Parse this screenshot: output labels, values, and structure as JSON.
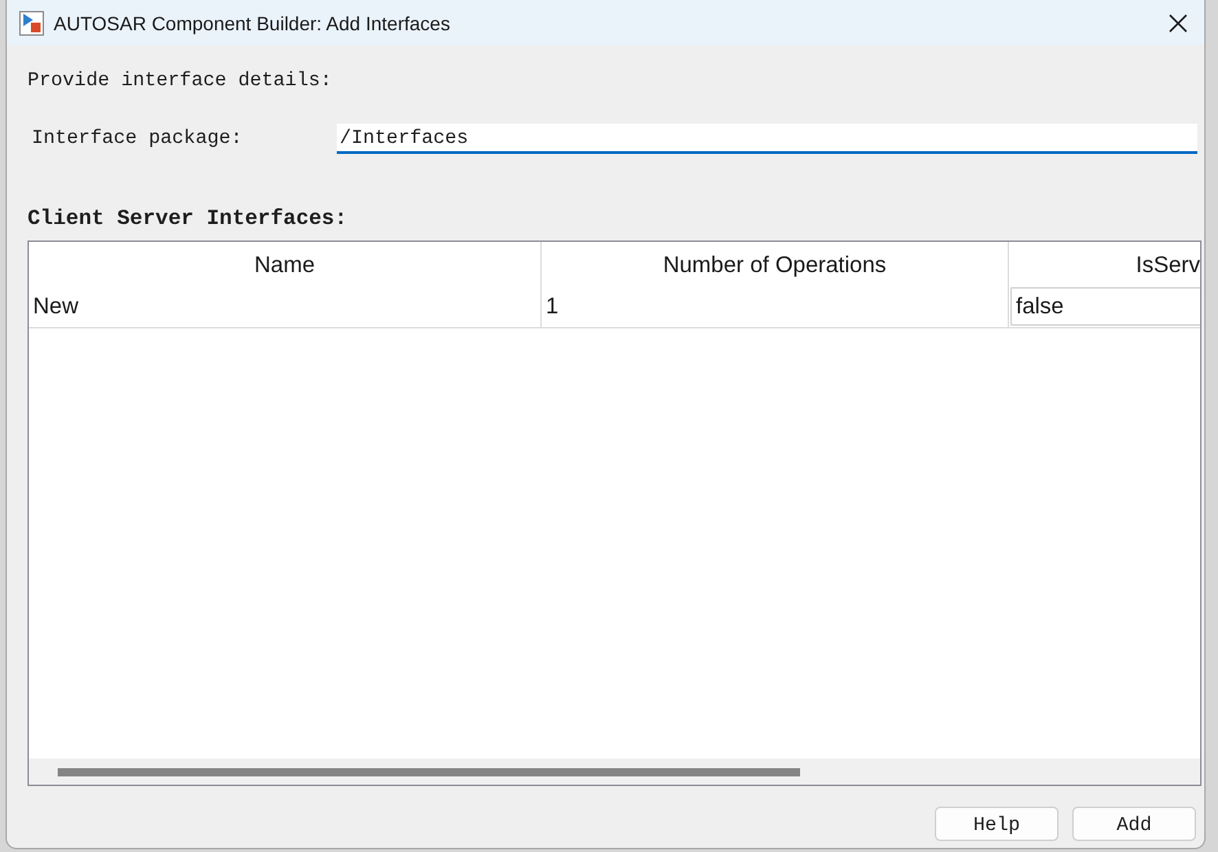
{
  "window": {
    "title": "AUTOSAR Component Builder: Add Interfaces"
  },
  "prompt": "Provide interface details:",
  "package_field": {
    "label": "Interface package:",
    "value": "/Interfaces"
  },
  "table": {
    "title": "Client Server Interfaces:",
    "columns": [
      "Name",
      "Number of Operations",
      "IsServ"
    ],
    "rows": [
      {
        "cells": [
          {
            "kind": "text",
            "text": "New"
          },
          {
            "kind": "text",
            "text": "1"
          },
          {
            "kind": "field",
            "text": "false"
          }
        ]
      }
    ]
  },
  "buttons": [
    "Help",
    "Add"
  ]
}
